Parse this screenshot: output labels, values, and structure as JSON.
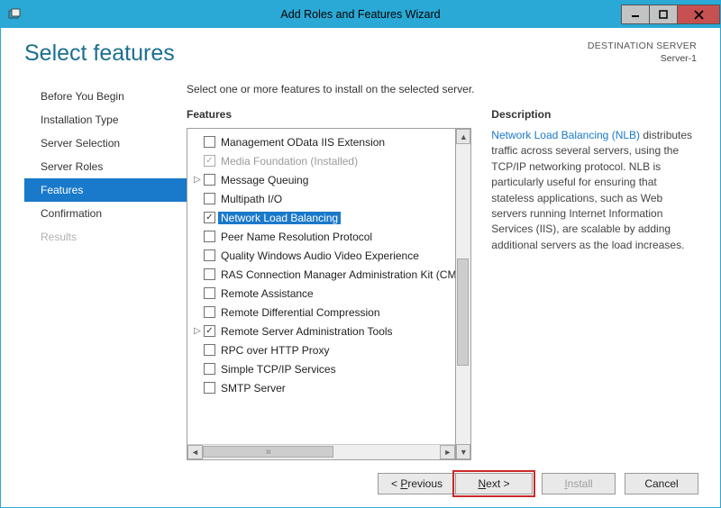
{
  "titlebar": {
    "title": "Add Roles and Features Wizard"
  },
  "header": {
    "page_title": "Select features",
    "destination_label": "DESTINATION SERVER",
    "destination_server": "Server-1"
  },
  "nav": {
    "items": [
      {
        "label": "Before You Begin"
      },
      {
        "label": "Installation Type"
      },
      {
        "label": "Server Selection"
      },
      {
        "label": "Server Roles"
      },
      {
        "label": "Features"
      },
      {
        "label": "Confirmation"
      },
      {
        "label": "Results"
      }
    ],
    "active_index": 4,
    "disabled_indices": [
      6
    ]
  },
  "main": {
    "instruction": "Select one or more features to install on the selected server.",
    "features_label": "Features",
    "description_label": "Description",
    "features": [
      {
        "label": "Management OData IIS Extension",
        "checked": false
      },
      {
        "label": "Media Foundation (Installed)",
        "checked": true,
        "installed": true
      },
      {
        "label": "Message Queuing",
        "checked": false,
        "expandable": true
      },
      {
        "label": "Multipath I/O",
        "checked": false
      },
      {
        "label": "Network Load Balancing",
        "checked": true,
        "selected": true
      },
      {
        "label": "Peer Name Resolution Protocol",
        "checked": false
      },
      {
        "label": "Quality Windows Audio Video Experience",
        "checked": false
      },
      {
        "label": "RAS Connection Manager Administration Kit (CMAK)",
        "checked": false
      },
      {
        "label": "Remote Assistance",
        "checked": false
      },
      {
        "label": "Remote Differential Compression",
        "checked": false
      },
      {
        "label": "Remote Server Administration Tools",
        "checked": true,
        "expandable": true
      },
      {
        "label": "RPC over HTTP Proxy",
        "checked": false
      },
      {
        "label": "Simple TCP/IP Services",
        "checked": false
      },
      {
        "label": "SMTP Server",
        "checked": false
      }
    ],
    "description_link": "Network Load Balancing (NLB)",
    "description_text": " distributes traffic across several servers, using the TCP/IP networking protocol. NLB is particularly useful for ensuring that stateless applications, such as Web servers running Internet Information Services (IIS), are scalable by adding additional servers as the load increases."
  },
  "buttons": {
    "previous": "< Previous",
    "next": "Next >",
    "install": "Install",
    "cancel": "Cancel"
  }
}
